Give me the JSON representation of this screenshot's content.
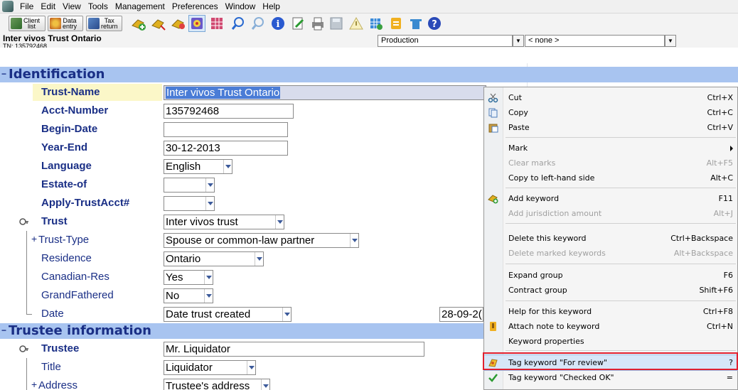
{
  "menubar": {
    "items": [
      "File",
      "Edit",
      "View",
      "Tools",
      "Management",
      "Preferences",
      "Window",
      "Help"
    ]
  },
  "toolbar": {
    "buttons": [
      {
        "label_line1": "Client",
        "label_line2": "list",
        "icon": "client-list-icon"
      },
      {
        "label_line1": "Data",
        "label_line2": "entry",
        "icon": "data-entry-icon"
      },
      {
        "label_line1": "Tax",
        "label_line2": "return",
        "icon": "tax-return-icon"
      }
    ],
    "icons": [
      "add-keyword-icon",
      "navigate-icon",
      "tag-icon",
      "diagnostics-icon",
      "grid-icon",
      "search-icon",
      "search-next-icon",
      "info-icon",
      "edit-icon",
      "print-icon",
      "save-icon",
      "warning-icon",
      "calculator-icon",
      "note-icon",
      "window-icon",
      "help-icon"
    ]
  },
  "document": {
    "title": "Inter vivos Trust Ontario",
    "tn": "TN: 135792468",
    "mode_combo": "Production",
    "filter_combo": "< none >"
  },
  "sections": {
    "identification": "Identification",
    "trustee_information": "Trustee information"
  },
  "fields": {
    "trust_name": {
      "label": "Trust-Name",
      "value": "Inter vivos Trust Ontario"
    },
    "acct_number": {
      "label": "Acct-Number",
      "value": "135792468"
    },
    "begin_date": {
      "label": "Begin-Date",
      "value": ""
    },
    "year_end": {
      "label": "Year-End",
      "value": "30-12-2013"
    },
    "language": {
      "label": "Language",
      "value": "English"
    },
    "estate_of": {
      "label": "Estate-of",
      "value": ""
    },
    "apply_trustacct": {
      "label": "Apply-TrustAcct#",
      "value": ""
    },
    "trust": {
      "label": "Trust",
      "value": "Inter vivos trust"
    },
    "trust_type": {
      "label": "Trust-Type",
      "value": "Spouse or common-law partner"
    },
    "residence": {
      "label": "Residence",
      "value": "Ontario"
    },
    "canadian_res": {
      "label": "Canadian-Res",
      "value": "Yes"
    },
    "grandfathered": {
      "label": "GrandFathered",
      "value": "No"
    },
    "date": {
      "label": "Date",
      "value": "Date trust created",
      "date_value": "28-09-2("
    },
    "trustee": {
      "label": "Trustee",
      "value": "Mr. Liquidator"
    },
    "title": {
      "label": "Title",
      "value": "Liquidator"
    },
    "address": {
      "label": "Address",
      "value": "Trustee's address"
    }
  },
  "context_menu": {
    "items": [
      {
        "label": "Cut",
        "shortcut": "Ctrl+X",
        "icon": "cut-icon",
        "disabled": false
      },
      {
        "label": "Copy",
        "shortcut": "Ctrl+C",
        "icon": "copy-icon",
        "disabled": false
      },
      {
        "label": "Paste",
        "shortcut": "Ctrl+V",
        "icon": "paste-icon",
        "disabled": false
      },
      {
        "label": "Mark",
        "shortcut": "",
        "icon": "",
        "disabled": false
      },
      {
        "label": "Clear marks",
        "shortcut": "Alt+F5",
        "icon": "",
        "disabled": true
      },
      {
        "label": "Copy to left-hand side",
        "shortcut": "Alt+C",
        "icon": "",
        "disabled": false
      },
      {
        "label": "Add keyword",
        "shortcut": "F11",
        "icon": "add-keyword-icon",
        "disabled": false
      },
      {
        "label": "Add jurisdiction amount",
        "shortcut": "Alt+J",
        "icon": "",
        "disabled": true
      },
      {
        "label": "Delete this keyword",
        "shortcut": "Ctrl+Backspace",
        "icon": "",
        "disabled": false
      },
      {
        "label": "Delete marked keywords",
        "shortcut": "Alt+Backspace",
        "icon": "",
        "disabled": true
      },
      {
        "label": "Expand group",
        "shortcut": "F6",
        "icon": "",
        "disabled": false
      },
      {
        "label": "Contract group",
        "shortcut": "Shift+F6",
        "icon": "",
        "disabled": false
      },
      {
        "label": "Help for this keyword",
        "shortcut": "Ctrl+F8",
        "icon": "",
        "disabled": false
      },
      {
        "label": "Attach note to keyword",
        "shortcut": "Ctrl+N",
        "icon": "note-icon",
        "disabled": false
      },
      {
        "label": "Keyword properties",
        "shortcut": "",
        "icon": "",
        "disabled": false
      },
      {
        "label": "Tag keyword \"For review\"",
        "shortcut": "?",
        "icon": "review-tag-icon",
        "disabled": false
      },
      {
        "label": "Tag keyword \"Checked OK\"",
        "shortcut": "=",
        "icon": "checkmark-icon",
        "disabled": false
      }
    ]
  },
  "colors": {
    "label_blue": "#1a2f86",
    "section_bg": "#a8c4f0",
    "highlight_red": "#e02030",
    "selection_blue": "#4a7cd6"
  }
}
